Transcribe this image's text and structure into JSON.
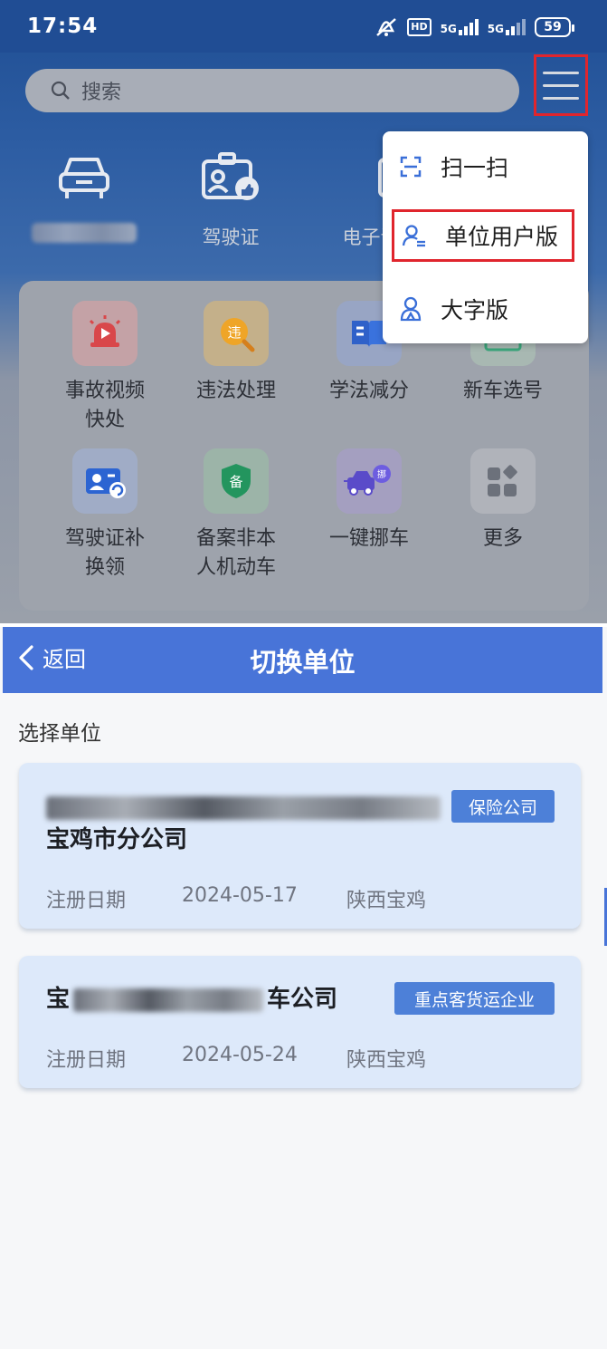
{
  "status_bar": {
    "time": "17:54",
    "network1": "5G",
    "network2": "5G",
    "battery": "59"
  },
  "top_screen": {
    "search_placeholder": "搜索",
    "quick_items": [
      {
        "label": "",
        "icon": "car-icon"
      },
      {
        "label": "驾驶证",
        "icon": "license-icon"
      },
      {
        "label": "电子证",
        "icon": "e-cert-icon"
      }
    ],
    "service_grid": [
      {
        "label": "事故视频快处",
        "icon": "alarm-icon",
        "color": "#e74c4c"
      },
      {
        "label": "违法处理",
        "icon": "violation-icon",
        "color": "#f3a82b"
      },
      {
        "label": "学法减分",
        "icon": "book-icon",
        "color": "#3a6fd8"
      },
      {
        "label": "新车选号",
        "icon": "plate-icon",
        "color": "#3db88a"
      },
      {
        "label": "驾驶证补换领",
        "icon": "license-renew-icon",
        "color": "#3a6fd8"
      },
      {
        "label": "备案非本人机动车",
        "icon": "record-icon",
        "color": "#2ea36a"
      },
      {
        "label": "一键挪车",
        "icon": "move-car-icon",
        "color": "#6b5bd6"
      },
      {
        "label": "更多",
        "icon": "more-icon",
        "color": "#707580"
      }
    ],
    "dropdown_menu": [
      {
        "label": "扫一扫",
        "icon": "scan-icon"
      },
      {
        "label": "单位用户版",
        "icon": "unit-user-icon"
      },
      {
        "label": "大字版",
        "icon": "large-font-icon"
      }
    ]
  },
  "bottom_screen": {
    "back_label": "返回",
    "title": "切换单位",
    "section_label": "选择单位",
    "date_label": "注册日期",
    "companies": [
      {
        "name_line2": "宝鸡市分公司",
        "tag": "保险公司",
        "date": "2024-05-17",
        "region": "陕西宝鸡"
      },
      {
        "name_prefix": "宝",
        "name_suffix": "车公司",
        "tag": "重点客货运企业",
        "date": "2024-05-24",
        "region": "陕西宝鸡"
      }
    ]
  },
  "colors": {
    "primary": "#4874d8",
    "highlight_border": "#e0252d",
    "card_bg": "#dde9fa"
  }
}
